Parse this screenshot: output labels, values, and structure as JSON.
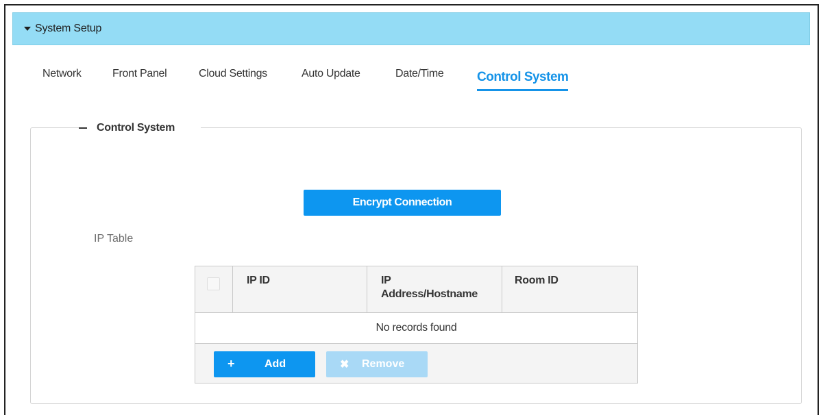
{
  "header": {
    "title": "System Setup"
  },
  "tabs": [
    {
      "label": "Network",
      "active": false
    },
    {
      "label": "Front Panel",
      "active": false
    },
    {
      "label": "Cloud Settings",
      "active": false
    },
    {
      "label": "Auto Update",
      "active": false
    },
    {
      "label": "Date/Time",
      "active": false
    },
    {
      "label": "Control System",
      "active": true
    }
  ],
  "section": {
    "title": "Control System",
    "encrypt_button": "Encrypt Connection",
    "ip_table_label": "IP Table"
  },
  "table": {
    "columns": [
      "IP ID",
      "IP Address/Hostname",
      "Room ID"
    ],
    "column_lines": [
      [
        "IP ID"
      ],
      [
        "IP",
        "Address/Hostname"
      ],
      [
        "Room ID"
      ]
    ],
    "empty_text": "No records found",
    "add_label": "Add",
    "remove_label": "Remove",
    "remove_enabled": false
  },
  "colors": {
    "accent": "#0d96f0",
    "header_bg": "#94dcf5",
    "tab_active": "#1593e8",
    "disabled_button": "#a9d9f6"
  }
}
